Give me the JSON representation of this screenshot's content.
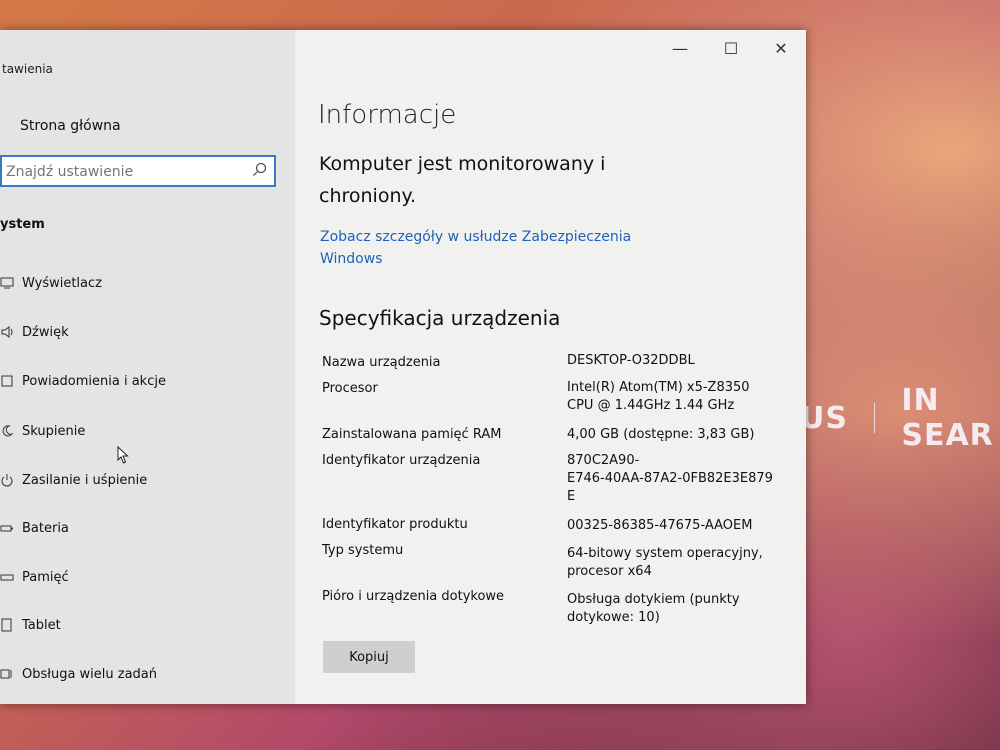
{
  "app": {
    "title": "tawienia"
  },
  "window_controls": {
    "minimize": "—",
    "maximize": "☐",
    "close": "✕"
  },
  "sidebar": {
    "home_label": "Strona główna",
    "search_placeholder": "Znajdź ustawienie",
    "section_label": "ystem",
    "items": [
      {
        "label": "Wyświetlacz",
        "icon": "display-icon"
      },
      {
        "label": "Dźwięk",
        "icon": "speaker-icon"
      },
      {
        "label": "Powiadomienia i akcje",
        "icon": "notification-icon"
      },
      {
        "label": "Skupienie",
        "icon": "moon-icon"
      },
      {
        "label": "Zasilanie i uśpienie",
        "icon": "power-icon"
      },
      {
        "label": "Bateria",
        "icon": "battery-icon"
      },
      {
        "label": "Pamięć",
        "icon": "storage-icon"
      },
      {
        "label": "Tablet",
        "icon": "tablet-icon"
      },
      {
        "label": "Obsługa wielu zadań",
        "icon": "multitasking-icon"
      }
    ]
  },
  "main": {
    "title": "Informacje",
    "status_line1": "Komputer jest monitorowany i",
    "status_line2": "chroniony.",
    "link_line1": "Zobacz szczegóły w usłudze Zabezpieczenia",
    "link_line2": "Windows",
    "spec_title": "Specyfikacja urządzenia",
    "specs": [
      {
        "label": "Nazwa urządzenia",
        "value": [
          "DESKTOP-O32DDBL"
        ]
      },
      {
        "label": "Procesor",
        "value": [
          "Intel(R) Atom(TM) x5-Z8350",
          "CPU @ 1.44GHz   1.44 GHz"
        ]
      },
      {
        "label": "Zainstalowana pamięć RAM",
        "value": [
          "4,00 GB (dostępne: 3,83 GB)"
        ]
      },
      {
        "label": "Identyfikator urządzenia",
        "value": [
          "870C2A90-",
          "E746-40AA-87A2-0FB82E3E879",
          "E"
        ]
      },
      {
        "label": "Identyfikator produktu",
        "value": [
          "00325-86385-47675-AAOEM"
        ]
      },
      {
        "label": "Typ systemu",
        "value": [
          "64-bitowy system operacyjny,",
          "procesor x64"
        ]
      },
      {
        "label": "Pióro i urządzenia dotykowe",
        "value": [
          "Obsługa dotykiem (punkty",
          "dotykowe: 10)"
        ]
      }
    ],
    "copy_button": "Kopiuj"
  },
  "wallpaper": {
    "brand": "US",
    "tagline": "IN SEAR"
  },
  "colors": {
    "accent": "#3a79c4",
    "link": "#1f63b8"
  }
}
